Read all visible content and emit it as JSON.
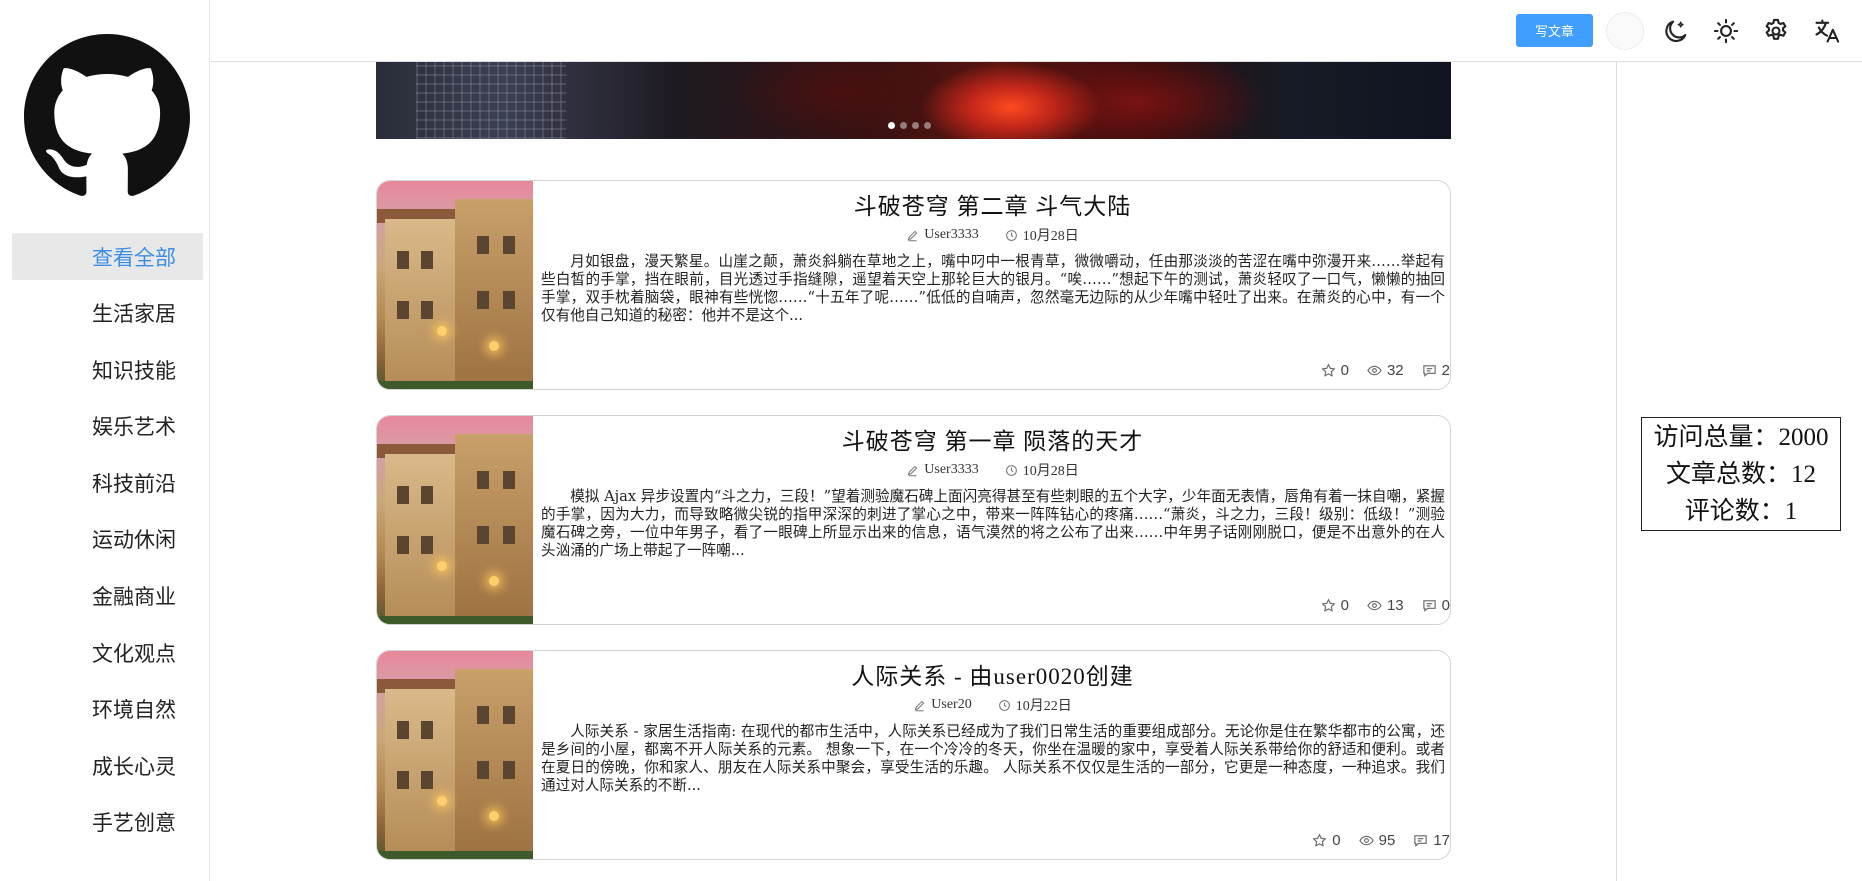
{
  "sidebar": {
    "logo_icon": "github-icon",
    "items": [
      {
        "label": "查看全部",
        "active": true
      },
      {
        "label": "生活家居"
      },
      {
        "label": "知识技能"
      },
      {
        "label": "娱乐艺术"
      },
      {
        "label": "科技前沿"
      },
      {
        "label": "运动休闲"
      },
      {
        "label": "金融商业"
      },
      {
        "label": "文化观点"
      },
      {
        "label": "环境自然"
      },
      {
        "label": "成长心灵"
      },
      {
        "label": "手艺创意"
      }
    ]
  },
  "header": {
    "write_button": "写文章",
    "icons": [
      "avatar",
      "moon-icon",
      "sun-icon",
      "gear-icon",
      "translate-icon"
    ],
    "accent_color": "#409eff"
  },
  "carousel": {
    "dot_count": 4,
    "active_index": 0
  },
  "articles": [
    {
      "title": "斗破苍穹 第二章 斗气大陆",
      "author": "User3333",
      "date": "10月28日",
      "excerpt": "月如银盘，漫天繁星。山崖之颠，萧炎斜躺在草地之上，嘴中叼中一根青草，微微嚼动，任由那淡淡的苦涩在嘴中弥漫开来……举起有些白皙的手掌，挡在眼前，目光透过手指缝隙，遥望着天空上那轮巨大的银月。“唉……”想起下午的测试，萧炎轻叹了一口气，懒懒的抽回手掌，双手枕着脑袋，眼神有些恍惚……“十五年了呢……”低低的自喃声，忽然毫无边际的从少年嘴中轻吐了出来。在萧炎的心中，有一个仅有他自己知道的秘密：他并不是这个...",
      "stars": "0",
      "views": "32",
      "comments": "2"
    },
    {
      "title": "斗破苍穹 第一章 陨落的天才",
      "author": "User3333",
      "date": "10月28日",
      "excerpt": "模拟 Ajax 异步设置内“斗之力，三段！”望着测验魔石碑上面闪亮得甚至有些刺眼的五个大字，少年面无表情，唇角有着一抹自嘲，紧握的手掌，因为大力，而导致略微尖锐的指甲深深的刺进了掌心之中，带来一阵阵钻心的疼痛……“萧炎，斗之力，三段！级别：低级！”测验魔石碑之旁，一位中年男子，看了一眼碑上所显示出来的信息，语气漠然的将之公布了出来……中年男子话刚刚脱口，便是不出意外的在人头汹涌的广场上带起了一阵嘲...",
      "stars": "0",
      "views": "13",
      "comments": "0"
    },
    {
      "title": "人际关系 - 由user0020创建",
      "author": "User20",
      "date": "10月22日",
      "excerpt": "人际关系 - 家居生活指南: 在现代的都市生活中，人际关系已经成为了我们日常生活的重要组成部分。无论你是住在繁华都市的公寓，还是乡间的小屋，都离不开人际关系的元素。 想象一下，在一个冷冷的冬天，你坐在温暖的家中，享受着人际关系带给你的舒适和便利。或者在夏日的傍晚，你和家人、朋友在人际关系中聚会，享受生活的乐趣。 人际关系不仅仅是生活的一部分，它更是一种态度，一种追求。我们通过对人际关系的不断...",
      "stars": "0",
      "views": "95",
      "comments": "17"
    }
  ],
  "stats": {
    "visits": "访问总量：2000",
    "articles": "文章总数：12",
    "comments": "评论数：1"
  }
}
